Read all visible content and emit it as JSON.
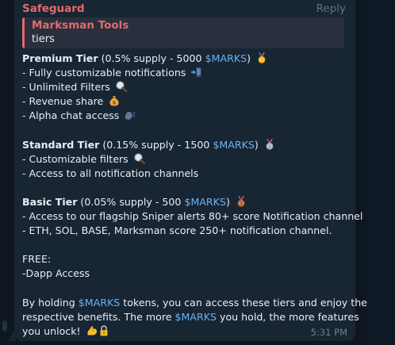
{
  "message": {
    "sender": "Safeguard",
    "reply_label": "Reply",
    "quote": {
      "title": "Marksman Tools",
      "text": "tiers"
    },
    "premium": {
      "name": "Premium Tier",
      "detail_pre": " (0.5% supply - 5000 ",
      "token": "$MARKS",
      "detail_post": ")",
      "items": [
        "- Fully customizable notifications",
        "- Unlimited Filters",
        "- Revenue share",
        "- Alpha chat access"
      ]
    },
    "standard": {
      "name": "Standard Tier",
      "detail_pre": " (0.15% supply - 1500 ",
      "token": "$MARKS",
      "detail_post": ")",
      "items": [
        "- Customizable filters",
        "- Access to all notification channels"
      ]
    },
    "basic": {
      "name": "Basic Tier",
      "detail_pre": " (0.05% supply - 500 ",
      "token": "$MARKS",
      "detail_post": ")",
      "items": [
        "- Access to our flagship Sniper alerts 80+ score Notification channel",
        "- ETH, SOL, BASE, Marksman score 250+ notification channel."
      ]
    },
    "free": {
      "heading": "FREE:",
      "item": "-Dapp Access"
    },
    "closing": {
      "l1_pre": "By holding ",
      "l1_token": "$MARKS",
      "l1_post": " tokens, you can access these tiers and enjoy the",
      "l2_pre": "respective benefits. The more ",
      "l2_token": "$MARKS",
      "l2_post": " you hold, the more features",
      "l3": "you unlock!"
    },
    "time": "5:31 PM"
  },
  "colors": {
    "background": "#0e1621",
    "bubble": "#182533",
    "sender": "#e56a6a",
    "link": "#6ab3f3",
    "text": "#e9eef4"
  },
  "icons": {
    "premium": "gold-medal-icon",
    "standard": "silver-medal-icon",
    "basic": "bronze-medal-icon",
    "notifications": "mobile-phone-icon",
    "filters": "magnifying-glass-icon",
    "revenue": "money-bag-icon",
    "alpha": "speaking-head-icon",
    "closing": [
      "flexed-biceps-icon",
      "locked-icon"
    ]
  }
}
